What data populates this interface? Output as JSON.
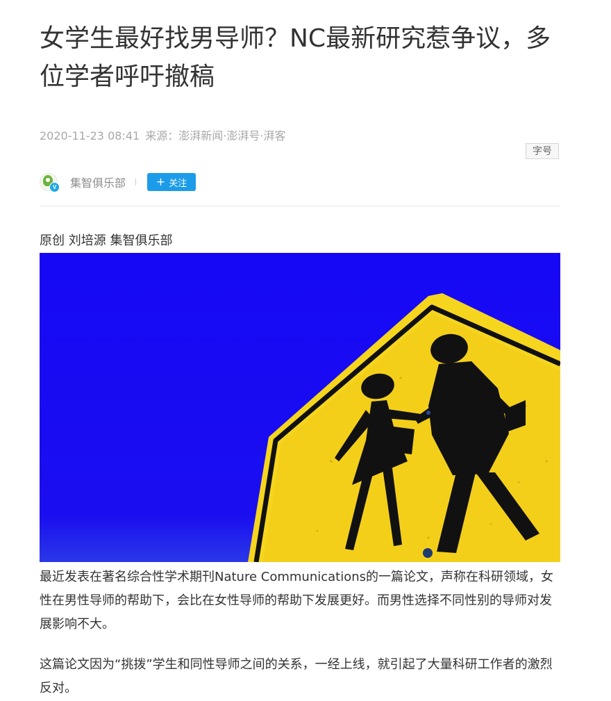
{
  "article": {
    "title": "女学生最好找男导师？NC最新研究惹争议，多位学者呼吁撤稿",
    "meta": {
      "datetime": "2020-11-23 08:41",
      "source_label": "来源：",
      "source": "澎湃新闻·澎湃号·湃客"
    },
    "font_size_button": "字号",
    "author": {
      "name": "集智俱乐部",
      "avatar_icon": "jizhi-logo-icon",
      "verified_badge": "V",
      "follow_icon": "+",
      "follow_label": "关注"
    },
    "byline": "原创 刘培源 集智俱乐部",
    "hero_image": {
      "subject": "school-crossing-sign",
      "colors": {
        "sky": "#1409f2",
        "sign": "#f6d51f",
        "border": "#111111"
      }
    },
    "paragraphs": [
      "最近发表在著名综合性学术期刊Nature Communications的一篇论文，声称在科研领域，女性在男性导师的帮助下，会比在女性导师的帮助下发展更好。而男性选择不同性别的导师对发展影响不大。",
      "这篇论文因为“挑拨”学生和同性导师之间的关系，一经上线，就引起了大量科研工作者的激烈反对。"
    ]
  },
  "colors": {
    "accent": "#1c9ce8",
    "text": "#333333",
    "meta_text": "#a8a8a8"
  }
}
